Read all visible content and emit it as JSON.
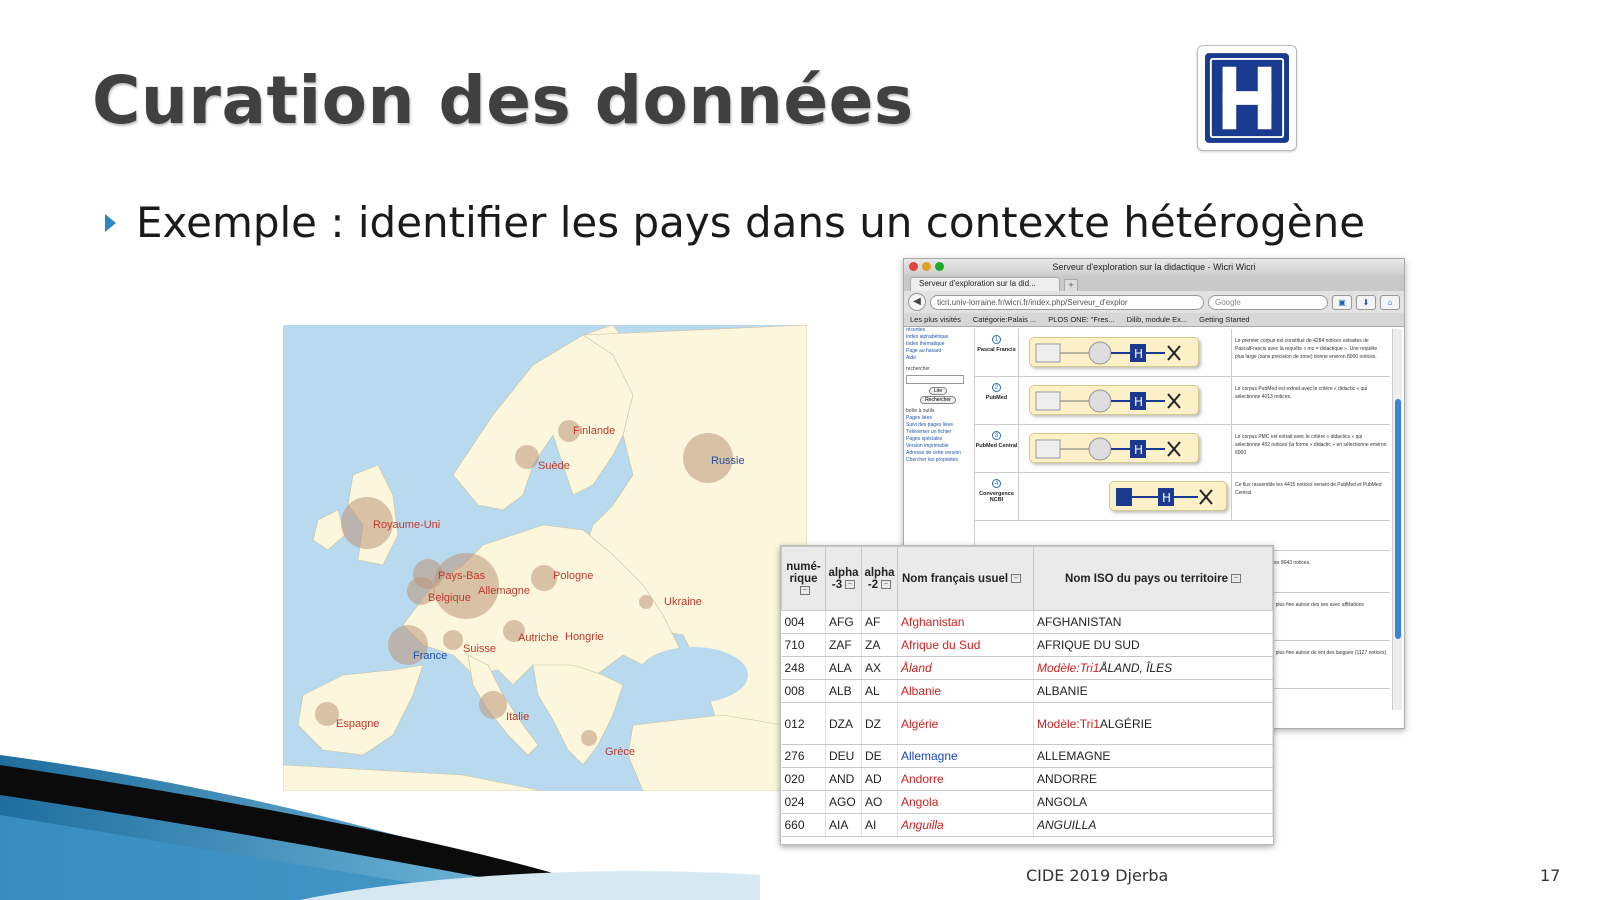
{
  "slide": {
    "title": "Curation des données",
    "bullet": "Exemple : identifier les pays dans un contexte hétérogène",
    "footer": "CIDE 2019 Djerba",
    "page_number": "17",
    "logo_letter": "H"
  },
  "map": {
    "labels": [
      {
        "name": "Finlande",
        "color": "#c0392b"
      },
      {
        "name": "Suède",
        "color": "#c0392b"
      },
      {
        "name": "Russie",
        "color": "#1f4fa0"
      },
      {
        "name": "Royaume-Uni",
        "color": "#c0392b"
      },
      {
        "name": "Pays-Bas",
        "color": "#c0392b"
      },
      {
        "name": "Allemagne",
        "color": "#c0392b"
      },
      {
        "name": "Belgique",
        "color": "#c0392b"
      },
      {
        "name": "Pologne",
        "color": "#c0392b"
      },
      {
        "name": "Ukraine",
        "color": "#c0392b"
      },
      {
        "name": "France",
        "color": "#1f4fa0"
      },
      {
        "name": "Suisse",
        "color": "#c0392b"
      },
      {
        "name": "Autriche",
        "color": "#c0392b"
      },
      {
        "name": "Hongrie",
        "color": "#c0392b"
      },
      {
        "name": "Espagne",
        "color": "#c0392b"
      },
      {
        "name": "Italie",
        "color": "#c0392b"
      },
      {
        "name": "Grèce",
        "color": "#c0392b"
      }
    ]
  },
  "browser": {
    "window_title": "Serveur d'exploration sur la didactique - Wicri Wicri",
    "tab_label": "Serveur d'exploration sur la did...",
    "url": "ticri.univ-lorraine.fr/wicri.fr/index.php/Serveur_d'explor",
    "search_placeholder": "Google",
    "bookmarks": [
      "Les plus visités",
      "Catégorie:Palais ...",
      "PLOS ONE: \"Fres...",
      "Dilib, module Ex...",
      "Getting Started"
    ],
    "sidebar": {
      "links_top": [
        "récentes",
        "Index alphabétique",
        "Index thématique",
        "Page au hasard",
        "Aide"
      ],
      "search_header": "rechercher",
      "btn_lire": "Lire",
      "btn_rechercher": "Rechercher",
      "tools_header": "boîte à outils",
      "links_tools": [
        "Pages liées",
        "Suivi des pages liées",
        "Téléverser un fichier",
        "Pages spéciales",
        "Version imprimable",
        "Adresse de cette version",
        "Chercher les propriétés"
      ]
    },
    "flows": [
      {
        "num": "1",
        "name": "Pascal Francis",
        "source": "Pascal Francis",
        "desc": "Le premier corpus est constitué de 4284 notices extraites de PascalFrancis avec la requête « mc = didactique ». Une requête plus large (sans précision de zone) donne environ 8000 notices."
      },
      {
        "num": "2",
        "name": "PubMed",
        "source": "PubMed",
        "desc": "Le corpus PubMed est extrait avec le critère « didactic » qui sélectionne 4013 notices."
      },
      {
        "num": "3",
        "name": "PubMed Central",
        "source": "PubMed Central",
        "desc": "Le corpus PMC est extrait avec le critère « didactics » qui sélectionne 402 notices (la forme « didactic » en sélectionne environ 6000"
      },
      {
        "num": "4",
        "name": "Convergence NCBI",
        "source": "NCBI",
        "desc": "Ce flux rassemble les 4415 notices venant de PubMed et PubMed Central"
      }
    ],
    "side_notes": [
      "emble la totalité des 8643 notices.",
      "pose une analyse plus fine autour des ses avec affiliations françaises (1296",
      "pose une analyse plus fine autour de ent des langues (1127 notices)"
    ]
  },
  "table": {
    "headers": [
      "numé-rique",
      "alpha -3",
      "alpha -2",
      "Nom français usuel",
      "Nom ISO du pays ou territoire"
    ],
    "rows": [
      {
        "num": "004",
        "a3": "AFG",
        "a2": "AF",
        "fr": "Afghanistan",
        "fr_style": "red",
        "iso_prefix": "",
        "iso": "AFGHANISTAN"
      },
      {
        "num": "710",
        "a3": "ZAF",
        "a2": "ZA",
        "fr": "Afrique du Sud",
        "fr_style": "red",
        "iso_prefix": "",
        "iso": "AFRIQUE DU SUD"
      },
      {
        "num": "248",
        "a3": "ALA",
        "a2": "AX",
        "fr": "Åland",
        "fr_style": "red-italic",
        "iso_prefix": "Modèle:Tri1",
        "iso": "ÅLAND, ÎLES"
      },
      {
        "num": "008",
        "a3": "ALB",
        "a2": "AL",
        "fr": "Albanie",
        "fr_style": "red",
        "iso_prefix": "",
        "iso": "ALBANIE"
      },
      {
        "num": "012",
        "a3": "DZA",
        "a2": "DZ",
        "fr": "Algérie",
        "fr_style": "red",
        "iso_prefix": "Modèle:Tri1",
        "iso": "ALGÉRIE"
      },
      {
        "num": "276",
        "a3": "DEU",
        "a2": "DE",
        "fr": "Allemagne",
        "fr_style": "blue",
        "iso_prefix": "",
        "iso": "ALLEMAGNE"
      },
      {
        "num": "020",
        "a3": "AND",
        "a2": "AD",
        "fr": "Andorre",
        "fr_style": "red",
        "iso_prefix": "",
        "iso": "ANDORRE"
      },
      {
        "num": "024",
        "a3": "AGO",
        "a2": "AO",
        "fr": "Angola",
        "fr_style": "red",
        "iso_prefix": "",
        "iso": "ANGOLA"
      },
      {
        "num": "660",
        "a3": "AIA",
        "a2": "AI",
        "fr": "Anguilla",
        "fr_style": "red-italic",
        "iso_prefix": "",
        "iso": "ANGUILLA"
      }
    ]
  },
  "colors": {
    "title": "#404040",
    "bullet_accent": "#2e86c1",
    "logo_blue": "#1a3a8f",
    "map_sea": "#b9d9ef",
    "map_land": "#fbf6dc",
    "link_red": "#cc2222",
    "link_blue": "#1b46b8"
  },
  "icons": [
    "bullet-arrow-icon",
    "hospital-h-icon",
    "back-arrow-icon",
    "sort-icon"
  ]
}
